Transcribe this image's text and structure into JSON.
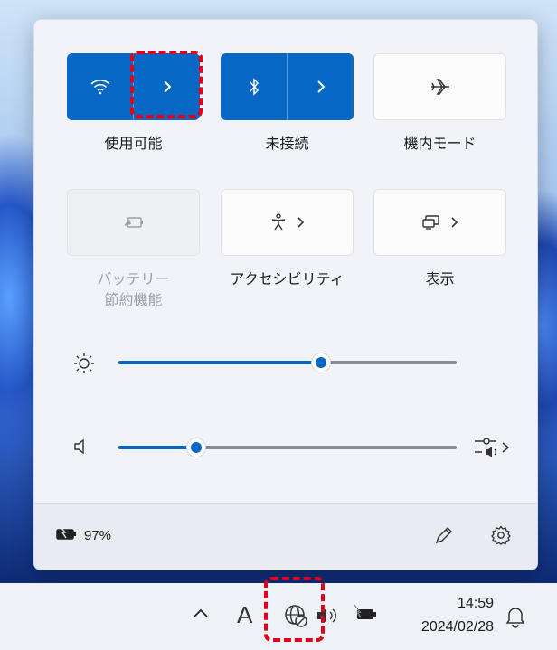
{
  "quick_settings": {
    "tiles": [
      {
        "label": "使用可能",
        "state": "on",
        "icon": "wifi-icon",
        "has_expand": true
      },
      {
        "label": "未接続",
        "state": "on",
        "icon": "bluetooth-icon",
        "has_expand": true
      },
      {
        "label": "機内モード",
        "state": "off",
        "icon": "airplane-icon",
        "has_expand": false
      },
      {
        "label": "バッテリー\n節約機能",
        "state": "disabled",
        "icon": "battery-saver-icon",
        "has_expand": false
      },
      {
        "label": "アクセシビリティ",
        "state": "off",
        "icon": "accessibility-icon",
        "has_expand": true
      },
      {
        "label": "表示",
        "state": "off",
        "icon": "cast-icon",
        "has_expand": true
      }
    ],
    "brightness": {
      "value": 0.6
    },
    "volume": {
      "value": 0.23
    },
    "footer": {
      "battery_text": "97%"
    }
  },
  "taskbar": {
    "time": "14:59",
    "date": "2024/02/28",
    "ime_label": "A"
  },
  "colors": {
    "accent": "#0767c5",
    "highlight": "#e0001b"
  }
}
